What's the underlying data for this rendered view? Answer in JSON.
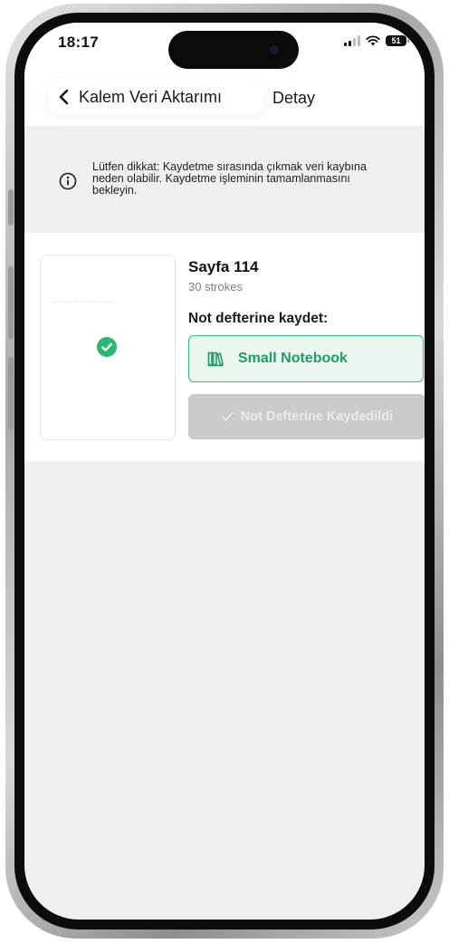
{
  "status_bar": {
    "time": "18:17",
    "battery": "51"
  },
  "nav": {
    "back_title": "Kalem Veri Aktarımı",
    "detail_title": "Detay"
  },
  "notice": {
    "text": "Lütfen dikkat: Kaydetme sırasında çıkmak veri kaybına neden olabilir. Kaydetme işleminin tamamlanmasını bekleyin."
  },
  "page": {
    "title": "Sayfa 114",
    "strokes": "30 strokes",
    "save_to_label": "Not defterine kaydet:",
    "notebook_name": "Small Notebook",
    "saved_button_label": "Not Defterine Kaydedildi",
    "saved": true
  },
  "colors": {
    "accent_green": "#3dbb7e",
    "notebook_text": "#1f9c63",
    "disabled_button": "#cacaca",
    "background": "#efefef"
  },
  "icons": {
    "back": "chevron-left-icon",
    "info": "info-circle-icon",
    "check": "check-circle-icon",
    "notebook": "books-icon",
    "saved": "checkmark-icon"
  }
}
